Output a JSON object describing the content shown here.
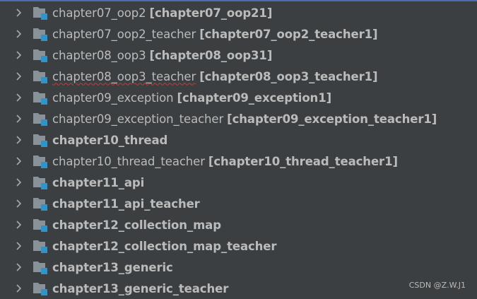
{
  "tree": {
    "items": [
      {
        "name": "chapter07_oop2",
        "qualifier": "[chapter07_oop21]",
        "bold": false,
        "squiggly": false
      },
      {
        "name": "chapter07_oop2_teacher",
        "qualifier": "[chapter07_oop2_teacher1]",
        "bold": false,
        "squiggly": false
      },
      {
        "name": "chapter08_oop3",
        "qualifier": "[chapter08_oop31]",
        "bold": false,
        "squiggly": false
      },
      {
        "name": "chapter08_oop3_teacher",
        "qualifier": "[chapter08_oop3_teacher1]",
        "bold": false,
        "squiggly": true
      },
      {
        "name": "chapter09_exception",
        "qualifier": "[chapter09_exception1]",
        "bold": false,
        "squiggly": false
      },
      {
        "name": "chapter09_exception_teacher",
        "qualifier": "[chapter09_exception_teacher1]",
        "bold": false,
        "squiggly": false
      },
      {
        "name": "chapter10_thread",
        "qualifier": "",
        "bold": true,
        "squiggly": false
      },
      {
        "name": "chapter10_thread_teacher",
        "qualifier": "[chapter10_thread_teacher1]",
        "bold": false,
        "squiggly": false
      },
      {
        "name": "chapter11_api",
        "qualifier": "",
        "bold": true,
        "squiggly": false
      },
      {
        "name": "chapter11_api_teacher",
        "qualifier": "",
        "bold": true,
        "squiggly": false
      },
      {
        "name": "chapter12_collection_map",
        "qualifier": "",
        "bold": true,
        "squiggly": false
      },
      {
        "name": "chapter12_collection_map_teacher",
        "qualifier": "",
        "bold": true,
        "squiggly": false
      },
      {
        "name": "chapter13_generic",
        "qualifier": "",
        "bold": true,
        "squiggly": false
      },
      {
        "name": "chapter13_generic_teacher",
        "qualifier": "",
        "bold": true,
        "squiggly": false
      }
    ],
    "icon": "module-folder-icon",
    "expander_icon": "chevron-right-icon"
  },
  "watermark": "CSDN @Z.W.J1",
  "colors": {
    "background": "#3c3f41",
    "text": "#bbbbbb",
    "folder": "#8a9299",
    "module_badge": "#3592c4",
    "selection_line": "#4b6eaf",
    "squiggle": "#bc3f3c"
  }
}
